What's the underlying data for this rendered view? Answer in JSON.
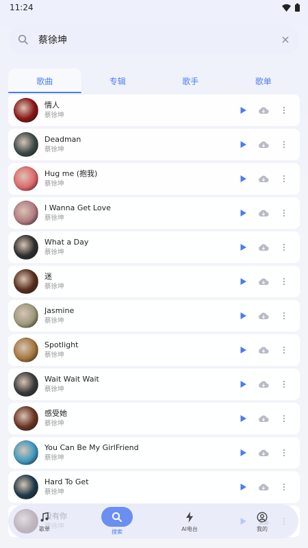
{
  "status": {
    "time": "11:24"
  },
  "search": {
    "value": "蔡徐坤"
  },
  "tabs": [
    {
      "label": "歌曲"
    },
    {
      "label": "专辑"
    },
    {
      "label": "歌手"
    },
    {
      "label": "歌单"
    }
  ],
  "songs": [
    {
      "title": "情人",
      "artist": "蔡徐坤",
      "cover": "#8a1616"
    },
    {
      "title": "Deadman",
      "artist": "蔡徐坤",
      "cover": "#3b4a48"
    },
    {
      "title": "Hug me (抱我)",
      "artist": "蔡徐坤",
      "cover": "#e0686b"
    },
    {
      "title": "I Wanna Get Love",
      "artist": "蔡徐坤",
      "cover": "#b27c82"
    },
    {
      "title": "What a Day",
      "artist": "蔡徐坤",
      "cover": "#2e2e2e"
    },
    {
      "title": "迷",
      "artist": "蔡徐坤",
      "cover": "#5a2e1e"
    },
    {
      "title": "Jasmine",
      "artist": "蔡徐坤",
      "cover": "#9c9a7c"
    },
    {
      "title": "Spotlight",
      "artist": "蔡徐坤",
      "cover": "#a5783e"
    },
    {
      "title": "Wait Wait Wait",
      "artist": "蔡徐坤",
      "cover": "#3a3a3a"
    },
    {
      "title": "感受她",
      "artist": "蔡徐坤",
      "cover": "#6a3422"
    },
    {
      "title": "You Can Be My GirlFriend",
      "artist": "蔡徐坤",
      "cover": "#3f9ac0"
    },
    {
      "title": "Hard To Get",
      "artist": "蔡徐坤",
      "cover": "#1e3a4a"
    },
    {
      "title": "没有你",
      "artist": "蔡徐坤",
      "cover": "#6b3a2a"
    }
  ],
  "nav": [
    {
      "label": "歌单"
    },
    {
      "label": "搜索"
    },
    {
      "label": "AI电台"
    },
    {
      "label": "我的"
    }
  ],
  "colors": {
    "accent": "#4d7cf0",
    "icon_gray": "#b8bbc4"
  }
}
